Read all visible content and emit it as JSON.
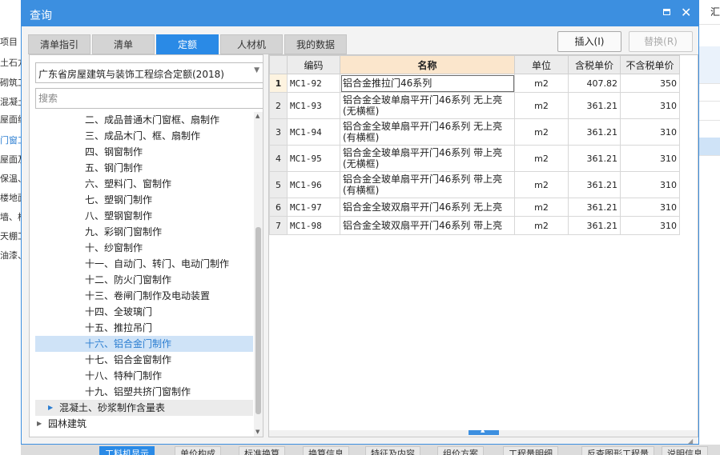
{
  "background": {
    "left_items": [
      "项目",
      "土石方",
      "砌筑工",
      "混凝土",
      "屋面绝",
      "门窗工",
      "屋面及",
      "保温、",
      "楼地面",
      "墙、柱",
      "天棚工",
      "油漆、"
    ],
    "right_header": "汇"
  },
  "dialog": {
    "title": "查询",
    "tabs": [
      "清单指引",
      "清单",
      "定额",
      "人材机",
      "我的数据"
    ],
    "active_tab": "定额",
    "insert_button": "插入(I)",
    "replace_button": "替换(R)"
  },
  "left_panel": {
    "quota_library": "广东省房屋建筑与装饰工程综合定额(2018)",
    "search_placeholder": "搜索",
    "tree": [
      {
        "label": "二、成品普通木门窗框、扇制作",
        "level": 2
      },
      {
        "label": "三、成品木门、框、扇制作",
        "level": 2
      },
      {
        "label": "四、钢窗制作",
        "level": 2
      },
      {
        "label": "五、钢门制作",
        "level": 2
      },
      {
        "label": "六、塑料门、窗制作",
        "level": 2
      },
      {
        "label": "七、塑钢门制作",
        "level": 2
      },
      {
        "label": "八、塑钢窗制作",
        "level": 2
      },
      {
        "label": "九、彩钢门窗制作",
        "level": 2
      },
      {
        "label": "十、纱窗制作",
        "level": 2
      },
      {
        "label": "十一、自动门、转门、电动门制作",
        "level": 2
      },
      {
        "label": "十二、防火门窗制作",
        "level": 2
      },
      {
        "label": "十三、卷闸门制作及电动装置",
        "level": 2
      },
      {
        "label": "十四、全玻璃门",
        "level": 2
      },
      {
        "label": "十五、推拉吊门",
        "level": 2
      },
      {
        "label": "十六、铝合金门制作",
        "level": 2,
        "selected": true
      },
      {
        "label": "十七、铝合金窗制作",
        "level": 2
      },
      {
        "label": "十八、特种门制作",
        "level": 2
      },
      {
        "label": "十九、铝塑共挤门窗制作",
        "level": 2
      },
      {
        "label": "混凝土、砂浆制作含量表",
        "level": 1,
        "collapsed": true,
        "highlight": true
      },
      {
        "label": "园林建筑",
        "level": 0,
        "collapsed": true
      }
    ]
  },
  "table": {
    "columns": [
      "编码",
      "名称",
      "单位",
      "含税单价",
      "不含税单价"
    ],
    "rows": [
      {
        "no": "1",
        "code": "MC1-92",
        "name": "铝合金推拉门46系列",
        "unit": "m2",
        "price_tax": "407.82",
        "price_notax": "350"
      },
      {
        "no": "2",
        "code": "MC1-93",
        "name": "铝合金全玻单扇平开门46系列 无上亮(无横框)",
        "unit": "m2",
        "price_tax": "361.21",
        "price_notax": "310"
      },
      {
        "no": "3",
        "code": "MC1-94",
        "name": "铝合金全玻单扇平开门46系列 无上亮(有横框)",
        "unit": "m2",
        "price_tax": "361.21",
        "price_notax": "310"
      },
      {
        "no": "4",
        "code": "MC1-95",
        "name": "铝合金全玻单扇平开门46系列 带上亮(无横框)",
        "unit": "m2",
        "price_tax": "361.21",
        "price_notax": "310"
      },
      {
        "no": "5",
        "code": "MC1-96",
        "name": "铝合金全玻单扇平开门46系列 带上亮(有横框)",
        "unit": "m2",
        "price_tax": "361.21",
        "price_notax": "310"
      },
      {
        "no": "6",
        "code": "MC1-97",
        "name": "铝合金全玻双扇平开门46系列 无上亮",
        "unit": "m2",
        "price_tax": "361.21",
        "price_notax": "310"
      },
      {
        "no": "7",
        "code": "MC1-98",
        "name": "铝合金全玻双扇平开门46系列 带上亮",
        "unit": "m2",
        "price_tax": "361.21",
        "price_notax": "310"
      }
    ]
  },
  "bottom_tabs": [
    "工料机显示",
    "单价构成",
    "标准换算",
    "换算信息",
    "特征及内容",
    "组价方案",
    "工程量明细",
    "反查图形工程量",
    "说明信息"
  ],
  "colors": {
    "accent": "#3c8fe0",
    "selected_tree_bg": "#cfe3f7",
    "name_header_bg": "#fbe6cc"
  }
}
